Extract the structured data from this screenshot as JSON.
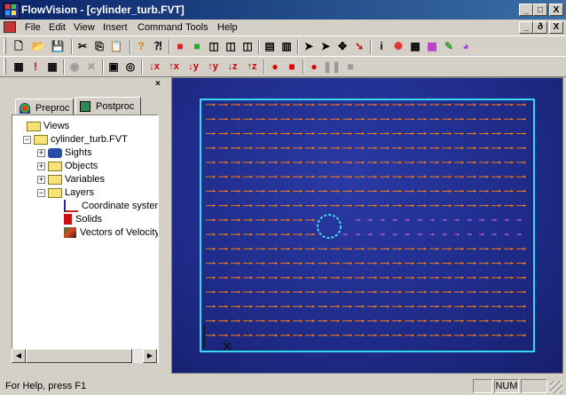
{
  "window": {
    "title": "FlowVision - [cylinder_turb.FVT]",
    "minimize_label": "_",
    "maximize_label": "□",
    "close_label": "X"
  },
  "menu": {
    "items": [
      "File",
      "Edit",
      "View",
      "Insert",
      "Command",
      "Tools",
      "Help"
    ]
  },
  "mdi": {
    "minimize_label": "_",
    "restore_label": "ð",
    "close_label": "X"
  },
  "toolbar1": [
    {
      "name": "new-file-icon",
      "glyph": "🗋"
    },
    {
      "name": "open-folder-icon",
      "glyph": "📂"
    },
    {
      "name": "save-icon",
      "glyph": "💾"
    },
    {
      "name": "cut-icon",
      "glyph": "✂"
    },
    {
      "name": "copy-icon",
      "glyph": "⎘"
    },
    {
      "name": "paste-icon",
      "glyph": "📋"
    },
    {
      "name": "help-icon",
      "glyph": "?"
    },
    {
      "name": "context-help-icon",
      "glyph": "⁈"
    },
    {
      "name": "red-box-icon",
      "glyph": "■"
    },
    {
      "name": "green-box-icon",
      "glyph": "■"
    },
    {
      "name": "wireframe-box-icon",
      "glyph": "◫"
    },
    {
      "name": "wireframe-box2-icon",
      "glyph": "◫"
    },
    {
      "name": "wireframe-box3-icon",
      "glyph": "◫"
    },
    {
      "name": "layout-icon",
      "glyph": "▤"
    },
    {
      "name": "layout2-icon",
      "glyph": "▥"
    },
    {
      "name": "pointer-icon",
      "glyph": "➤"
    },
    {
      "name": "pointer2-icon",
      "glyph": "➤"
    },
    {
      "name": "move-icon",
      "glyph": "✥"
    },
    {
      "name": "probe-icon",
      "glyph": "➘"
    },
    {
      "name": "info-icon",
      "glyph": "i"
    },
    {
      "name": "particles-icon",
      "glyph": "✺"
    },
    {
      "name": "mesh-icon",
      "glyph": "▦"
    },
    {
      "name": "color-icon",
      "glyph": "▩"
    },
    {
      "name": "graph-icon",
      "glyph": "✎"
    },
    {
      "name": "color-wheel-icon",
      "glyph": "◕"
    }
  ],
  "toolbar2": [
    {
      "name": "grid-icon",
      "glyph": "▦"
    },
    {
      "name": "exclamation-icon",
      "glyph": "!"
    },
    {
      "name": "grid2-icon",
      "glyph": "▦"
    },
    {
      "name": "record-grey-icon",
      "glyph": "◉"
    },
    {
      "name": "cross-icon",
      "glyph": "✕"
    },
    {
      "name": "frame-icon",
      "glyph": "▣"
    },
    {
      "name": "camera-icon",
      "glyph": "◎"
    },
    {
      "name": "rotate-minus-x-icon",
      "glyph": "↓x"
    },
    {
      "name": "rotate-plus-x-icon",
      "glyph": "↑x"
    },
    {
      "name": "rotate-minus-y-icon",
      "glyph": "↓y"
    },
    {
      "name": "rotate-plus-y-icon",
      "glyph": "↑y"
    },
    {
      "name": "rotate-minus-z-icon",
      "glyph": "↓z"
    },
    {
      "name": "rotate-plus-z-icon",
      "glyph": "↑z"
    },
    {
      "name": "step-icon",
      "glyph": "●"
    },
    {
      "name": "stop-record-icon",
      "glyph": "■"
    },
    {
      "name": "record-icon",
      "glyph": "●"
    },
    {
      "name": "pause-icon",
      "glyph": "❚❚"
    },
    {
      "name": "stop-icon",
      "glyph": "■"
    }
  ],
  "panel": {
    "close_label": "×",
    "tabs": [
      "Preproc",
      "Postproc"
    ],
    "tree": [
      {
        "label": "Views",
        "level": 0,
        "expander": ""
      },
      {
        "label": "cylinder_turb.FVT",
        "level": 1,
        "expander": "−"
      },
      {
        "label": "Sights",
        "level": 2,
        "expander": "+"
      },
      {
        "label": "Objects",
        "level": 2,
        "expander": "+"
      },
      {
        "label": "Variables",
        "level": 2,
        "expander": "+"
      },
      {
        "label": "Layers",
        "level": 2,
        "expander": "−"
      },
      {
        "label": "Coordinate system",
        "level": 3,
        "expander": ""
      },
      {
        "label": "Solids",
        "level": 3,
        "expander": ""
      },
      {
        "label": "Vectors of Velocity",
        "level": 3,
        "expander": ""
      }
    ]
  },
  "viewport": {
    "field": {
      "rows": 17,
      "cols": 26,
      "flow_direction": "positive-x",
      "inflow_color": "#e07a30",
      "wake_color": "#a060e0",
      "cylinder_color": "#40d8e8",
      "domain_border_color": "#3ad8f0",
      "background_color": "#1f2c8a"
    }
  },
  "status": {
    "text": "For Help, press F1",
    "num_label": "NUM"
  }
}
